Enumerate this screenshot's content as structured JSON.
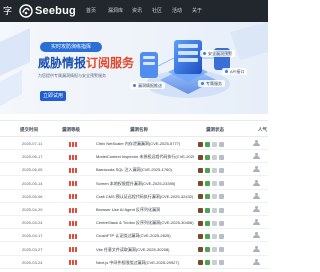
{
  "nav": {
    "brand_fragment": "字",
    "logo_text": "Seebug",
    "items": [
      "首页",
      "漏洞库",
      "资讯",
      "社区",
      "活动",
      "关于"
    ]
  },
  "banner": {
    "pill": "实时攻防演练指挥",
    "headline_main": "威胁情报",
    "headline_accent": "订阅服务",
    "subline": "为您提供专属漏洞情报与安全预警服务",
    "cta": "立即试用",
    "tags": [
      "安全漏洞预警",
      "漏洞情报推送",
      "专属服务",
      "API接口"
    ]
  },
  "table": {
    "headers": {
      "date": "提交时间",
      "severity": "漏洞等级",
      "name": "漏洞名称",
      "status": "漏洞状态",
      "people": "人气"
    },
    "rows": [
      {
        "date": "2025-07-11",
        "severity": "high",
        "name": "Citrix NetScaler 内存泄漏漏洞(CVE-2025-5777)"
      },
      {
        "date": "2025-06-17",
        "severity": "high",
        "name": "ModelContext Inspector 未授权远程代码执行(CVE-2025-49596)"
      },
      {
        "date": "2025-06-05",
        "severity": "high",
        "name": "Barracuda SQL 注入漏洞(CVE-2025-1760)"
      },
      {
        "date": "2025-05-14",
        "severity": "high",
        "name": "Screen 本地权限提升漏洞(CVE-2025-23395)"
      },
      {
        "date": "2025-05-06",
        "severity": "high",
        "name": "Craft CMS 预认证远程代码执行漏洞(CVE-2025-32432)"
      },
      {
        "date": "2025-04-29",
        "severity": "high",
        "name": "Browser Use AI Agent 反序列化漏洞"
      },
      {
        "date": "2025-04-24",
        "severity": "high",
        "name": "CentreStack & Triofox 反序列化漏洞(CVE-2025-30406)"
      },
      {
        "date": "2025-04-17",
        "severity": "high",
        "name": "CrushFTP 认证绕过漏洞(CVE-2025-2825)"
      },
      {
        "date": "2025-03-27",
        "severity": "high",
        "name": "Vite 任意文件读取漏洞(CVE-2025-30208)"
      },
      {
        "date": "2025-03-24",
        "severity": "high",
        "name": "Next.js 中间件权限绕过漏洞(CVE-2025-29927)"
      }
    ]
  },
  "colors": {
    "nav_bg": "#22262d",
    "accent_blue": "#1f5fd1",
    "accent_red": "#e2472b",
    "severity_high": "#e04a3b"
  }
}
